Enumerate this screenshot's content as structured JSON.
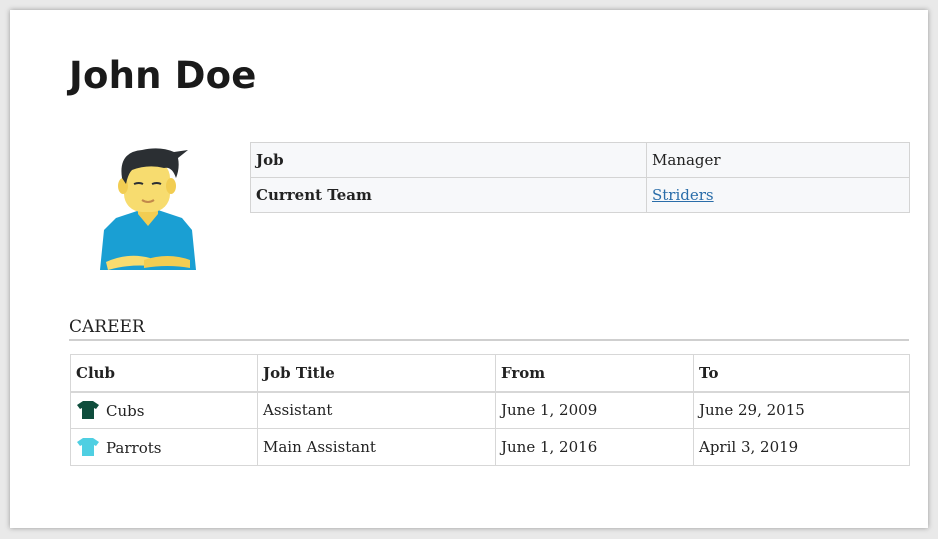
{
  "profile": {
    "name": "John Doe",
    "info": [
      {
        "label": "Job",
        "value": "Manager",
        "link": false
      },
      {
        "label": "Current Team",
        "value": "Striders",
        "link": true
      }
    ]
  },
  "career": {
    "heading": "CAREER",
    "columns": [
      "Club",
      "Job Title",
      "From",
      "To"
    ],
    "rows": [
      {
        "club": "Cubs",
        "shirt_color": "#0e4d3c",
        "job_title": "Assistant",
        "from": "June 1, 2009",
        "to": "June 29, 2015"
      },
      {
        "club": "Parrots",
        "shirt_color": "#4fcfe2",
        "job_title": "Main Assistant",
        "from": "June 1, 2016",
        "to": "April 3, 2019"
      }
    ]
  },
  "colors": {
    "link": "#2a6da9",
    "avatar_shirt": "#1a9fd3",
    "avatar_skin": "#f7dc6f",
    "avatar_hair": "#2b2f33"
  },
  "icons": [
    "avatar-illustration",
    "shirt-icon"
  ]
}
